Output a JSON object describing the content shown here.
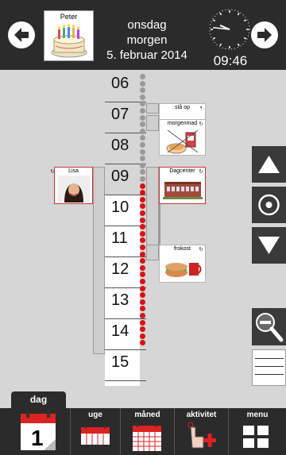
{
  "header": {
    "profile_name": "Peter",
    "weekday": "onsdag",
    "period": "morgen",
    "date": "5. februar 2014",
    "time": "09:46",
    "clock_time": {
      "hour": 9,
      "minute": 46
    }
  },
  "timeline": {
    "hours": [
      "06",
      "07",
      "08",
      "09",
      "10",
      "11",
      "12",
      "13",
      "14",
      "15"
    ],
    "now_marker": "09:46"
  },
  "activities": {
    "sta_op": {
      "title": "stå op"
    },
    "morgenmad": {
      "title": "morgenmad"
    },
    "dagcenter": {
      "title": "Dagcenter"
    },
    "frokost": {
      "title": "frokost"
    },
    "lisa": {
      "title": "Lisa"
    }
  },
  "controls": {
    "up": "up-arrow-icon",
    "center": "target-icon",
    "down": "down-arrow-icon",
    "zoom": "zoom-out-icon",
    "lines": "lines-icon"
  },
  "tabs": [
    {
      "id": "dag",
      "label": "dag",
      "active": true
    },
    {
      "id": "uge",
      "label": "uge",
      "active": false
    },
    {
      "id": "maaned",
      "label": "måned",
      "active": false
    },
    {
      "id": "aktivitet",
      "label": "aktivitet",
      "active": false
    },
    {
      "id": "menu",
      "label": "menu",
      "active": false
    }
  ],
  "colors": {
    "header": "#2b2b2b",
    "background": "#d6d6d6",
    "past_dot": "#9a9a9a",
    "future_dot": "#dd1111",
    "accent_red": "#dd2222"
  }
}
